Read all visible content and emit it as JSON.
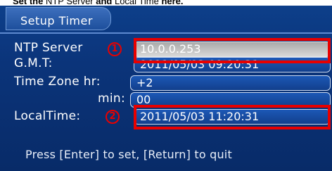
{
  "doc_caption": {
    "part1": "Set the",
    "part2": " NTP Server ",
    "part3": "and",
    "part4": " Local Time ",
    "part5": "here."
  },
  "screen": {
    "title": "Setup Timer",
    "fields": {
      "ntp_server": {
        "label": "NTP Server",
        "value": "10.0.0.253"
      },
      "gmt": {
        "label": "G.M.T:",
        "value": "2011/05/03 09:20:31"
      },
      "tz_hr": {
        "label": "Time Zone hr:",
        "value": "+2"
      },
      "tz_min": {
        "label": "min:",
        "value": "00"
      },
      "local_time": {
        "label": "LocalTime:",
        "value": "2011/05/03 11:20:31"
      }
    },
    "annotations": {
      "marker1": "1",
      "marker2": "2"
    },
    "footer": "Press [Enter] to set, [Return] to quit"
  },
  "colors": {
    "screen_bg": "#0b347a",
    "highlight": "#e80000",
    "text": "#ffffff"
  }
}
